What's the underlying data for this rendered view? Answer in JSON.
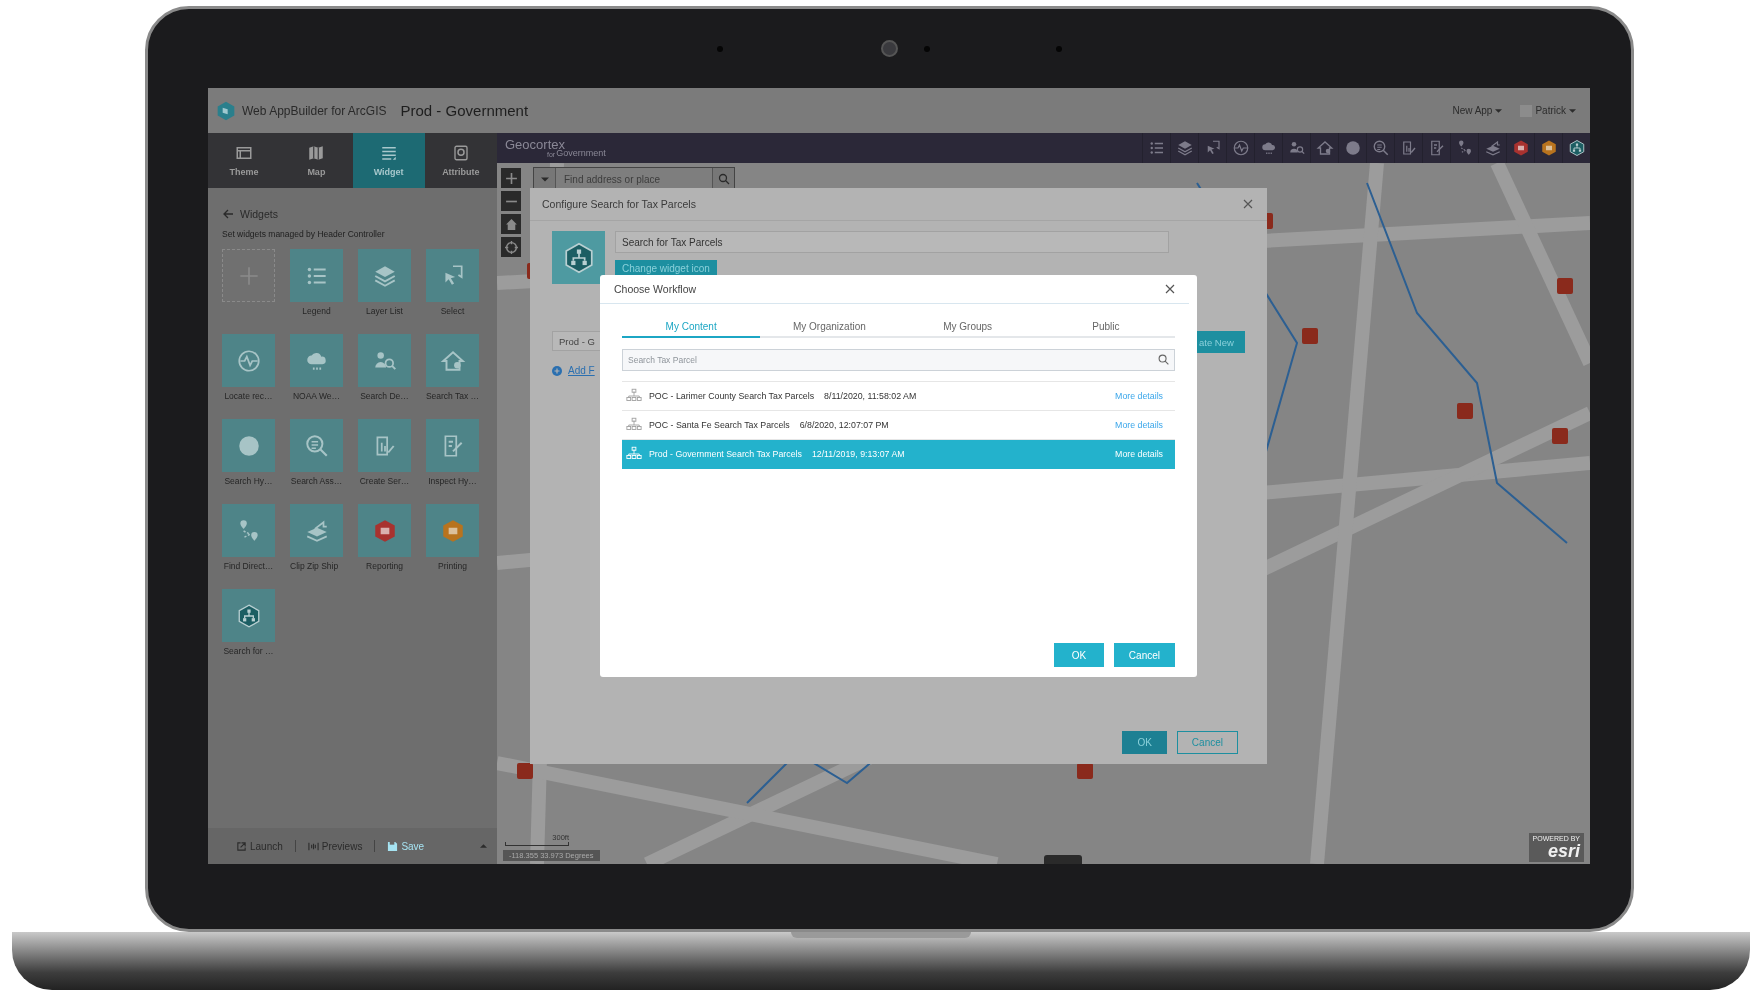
{
  "app_header": {
    "product": "Web AppBuilder for ArcGIS",
    "app_title": "Prod - Government",
    "menus": [
      {
        "label": "New App"
      },
      {
        "label": "Patrick"
      }
    ]
  },
  "builder_tabs": [
    {
      "label": "Theme",
      "selected": false
    },
    {
      "label": "Map",
      "selected": false
    },
    {
      "label": "Widget",
      "selected": true
    },
    {
      "label": "Attribute",
      "selected": false
    }
  ],
  "widgets_panel": {
    "back_label": "Widgets",
    "hint": "Set widgets managed by Header Controller",
    "widgets": [
      {
        "kind": "add"
      },
      {
        "kind": "widget",
        "label": "Legend"
      },
      {
        "kind": "widget",
        "label": "Layer List"
      },
      {
        "kind": "widget",
        "label": "Select"
      },
      {
        "kind": "widget",
        "label": "Locate rec…"
      },
      {
        "kind": "widget",
        "label": "NOAA We…"
      },
      {
        "kind": "widget",
        "label": "Search De…"
      },
      {
        "kind": "widget",
        "label": "Search Tax …"
      },
      {
        "kind": "widget",
        "label": "Search Hy…"
      },
      {
        "kind": "widget",
        "label": "Search Ass…"
      },
      {
        "kind": "widget",
        "label": "Create Ser…"
      },
      {
        "kind": "widget",
        "label": "Inspect Hy…"
      },
      {
        "kind": "widget",
        "label": "Find Direct…"
      },
      {
        "kind": "widget",
        "label": "Clip Zip Ship"
      },
      {
        "kind": "widget",
        "label": "Reporting"
      },
      {
        "kind": "widget",
        "label": "Printing"
      },
      {
        "kind": "widget",
        "label": "Search for …"
      }
    ],
    "footer": [
      {
        "label": "Launch",
        "highlighted": false
      },
      {
        "label": "Previews",
        "highlighted": false
      },
      {
        "label": "Save",
        "highlighted": true
      }
    ]
  },
  "map": {
    "brand": "Geocortex",
    "brand_for": "for",
    "brand_sub": "Government",
    "search_placeholder": "Find address or place",
    "scale": "300ft",
    "coordinates": "-118.355 33.973 Degrees",
    "attribution_prefix": "POWERED BY",
    "attribution": "esri"
  },
  "config_dialog": {
    "title": "Configure Search for Tax Parcels",
    "name_value": "Search for Tax Parcels",
    "change_icon_label": "Change widget icon",
    "workflow_value": "Prod - G",
    "create_label": "ate New",
    "add_link": "Add F",
    "buttons": [
      {
        "label": "OK",
        "primary": true
      },
      {
        "label": "Cancel",
        "primary": false
      }
    ]
  },
  "choose_workflow": {
    "title": "Choose Workflow",
    "tabs": [
      {
        "label": "My Content",
        "selected": true
      },
      {
        "label": "My Organization",
        "selected": false
      },
      {
        "label": "My Groups",
        "selected": false
      },
      {
        "label": "Public",
        "selected": false
      }
    ],
    "search_placeholder": "Search Tax Parcel",
    "rows": [
      {
        "name": "POC - Larimer County Search Tax Parcels",
        "date": "8/11/2020, 11:58:02 AM",
        "link": "More details",
        "selected": false
      },
      {
        "name": "POC - Santa Fe Search Tax Parcels",
        "date": "6/8/2020, 12:07:07 PM",
        "link": "More details",
        "selected": false
      },
      {
        "name": "Prod - Government Search Tax Parcels",
        "date": "12/11/2019, 9:13:07 AM",
        "link": "More details",
        "selected": true
      }
    ],
    "buttons": [
      {
        "label": "OK"
      },
      {
        "label": "Cancel"
      }
    ]
  }
}
